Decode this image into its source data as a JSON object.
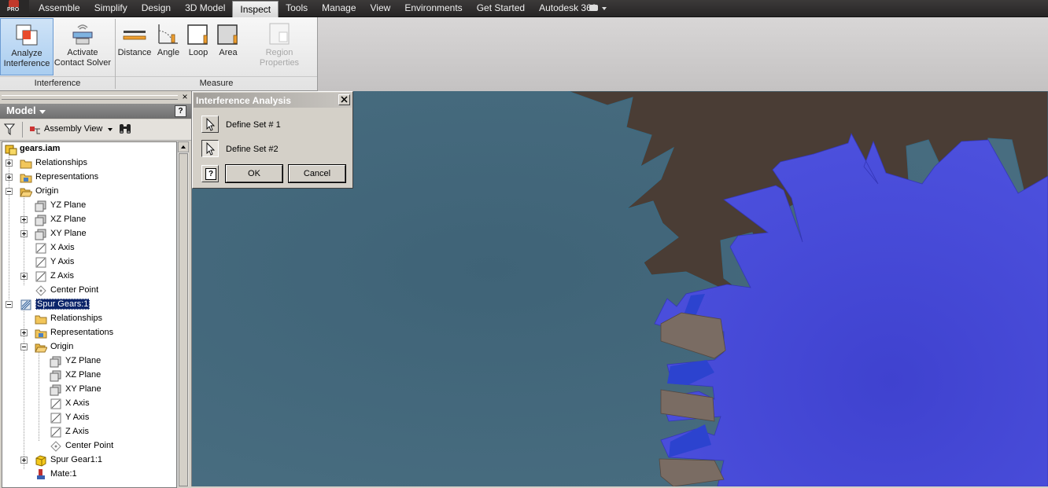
{
  "menubar": {
    "logo_text": "PRO",
    "tabs": [
      "Assemble",
      "Simplify",
      "Design",
      "3D Model",
      "Inspect",
      "Tools",
      "Manage",
      "View",
      "Environments",
      "Get Started",
      "Autodesk 360"
    ],
    "active_tab": "Inspect"
  },
  "ribbon": {
    "interference_panel": {
      "label": "Interference",
      "analyze": {
        "line1": "Analyze",
        "line2": "Interference"
      },
      "contact": {
        "line1": "Activate",
        "line2": "Contact Solver"
      }
    },
    "measure_panel": {
      "label": "Measure",
      "distance": "Distance",
      "angle": "Angle",
      "loop": "Loop",
      "area": "Area",
      "region": "Region Properties"
    }
  },
  "browser": {
    "title": "Model",
    "view_label": "Assembly View",
    "tree": [
      {
        "label": "gears.iam",
        "icon": "assembly-icon"
      },
      {
        "label": "Relationships",
        "icon": "folder-icon"
      },
      {
        "label": "Representations",
        "icon": "representations-icon"
      },
      {
        "label": "Origin",
        "icon": "open-folder-icon"
      },
      {
        "label": "YZ Plane",
        "icon": "plane-icon"
      },
      {
        "label": "XZ Plane",
        "icon": "plane-icon"
      },
      {
        "label": "XY Plane",
        "icon": "plane-icon"
      },
      {
        "label": "X Axis",
        "icon": "axis-icon"
      },
      {
        "label": "Y Axis",
        "icon": "axis-icon"
      },
      {
        "label": "Z Axis",
        "icon": "axis-icon"
      },
      {
        "label": "Center Point",
        "icon": "center-point-icon"
      },
      {
        "label": "Spur Gears:1",
        "icon": "gear-component-icon"
      },
      {
        "label": "Relationships",
        "icon": "folder-icon"
      },
      {
        "label": "Representations",
        "icon": "representations-icon"
      },
      {
        "label": "Origin",
        "icon": "open-folder-icon"
      },
      {
        "label": "YZ Plane",
        "icon": "plane-icon"
      },
      {
        "label": "XZ Plane",
        "icon": "plane-icon"
      },
      {
        "label": "XY Plane",
        "icon": "plane-icon"
      },
      {
        "label": "X Axis",
        "icon": "axis-icon"
      },
      {
        "label": "Y Axis",
        "icon": "axis-icon"
      },
      {
        "label": "Z Axis",
        "icon": "axis-icon"
      },
      {
        "label": "Center Point",
        "icon": "center-point-icon"
      },
      {
        "label": "Spur Gear1:1",
        "icon": "part-icon"
      },
      {
        "label": "Mate:1",
        "icon": "mate-icon"
      }
    ]
  },
  "dialog": {
    "title": "Interference Analysis",
    "set1_label": "Define Set # 1",
    "set2_label": "Define Set #2",
    "ok_label": "OK",
    "cancel_label": "Cancel"
  },
  "colors": {
    "viewport_background": "#45687b",
    "gear_brown": "#4a3d35",
    "gear_blue": "#4548d8",
    "interference": "#2f46d0",
    "selection": "#0a246a"
  }
}
